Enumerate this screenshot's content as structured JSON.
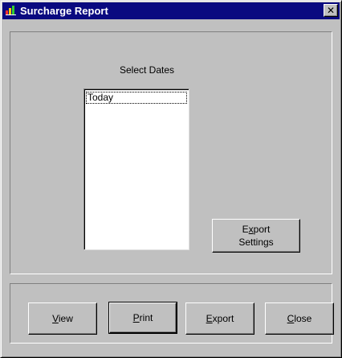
{
  "window": {
    "title": "Surcharge Report",
    "close_glyph": "✕",
    "icon": "app-icon"
  },
  "dates": {
    "label": "Select Dates",
    "items": [
      "Today"
    ]
  },
  "buttons": {
    "export_settings": {
      "line1_prefix": "E",
      "line1_accel": "x",
      "line1_rest": "port",
      "line2": "Settings"
    },
    "view": {
      "accel": "V",
      "rest": "iew"
    },
    "print": {
      "accel": "P",
      "rest": "rint"
    },
    "export": {
      "accel": "E",
      "rest": "xport"
    },
    "close": {
      "accel": "C",
      "rest": "lose"
    }
  }
}
